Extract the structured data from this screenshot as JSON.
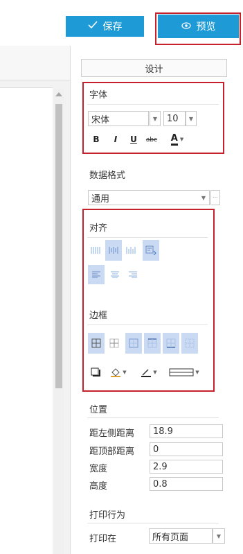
{
  "toolbar": {
    "save_label": "保存",
    "preview_label": "预览",
    "save_icon": "check-icon",
    "preview_icon": "eye-icon",
    "accent": "#1e9bd7",
    "highlight": "#c6202c"
  },
  "panel": {
    "design_label": "设计",
    "font": {
      "title": "字体",
      "family": "宋体",
      "size": "10",
      "bold": "B",
      "italic": "I",
      "underline": "U",
      "strike": "abc",
      "color": "A"
    },
    "data_format": {
      "title": "数据格式",
      "value": "通用",
      "more": "···"
    },
    "align": {
      "title": "对齐"
    },
    "border": {
      "title": "边框"
    },
    "position": {
      "title": "位置",
      "left_label": "距左侧距离",
      "left_value": "18.9",
      "top_label": "距顶部距离",
      "top_value": "0",
      "width_label": "宽度",
      "width_value": "2.9",
      "height_label": "高度",
      "height_value": "0.8"
    },
    "print": {
      "title": "打印行为",
      "print_on_label": "打印在",
      "print_on_value": "所有页面"
    }
  }
}
